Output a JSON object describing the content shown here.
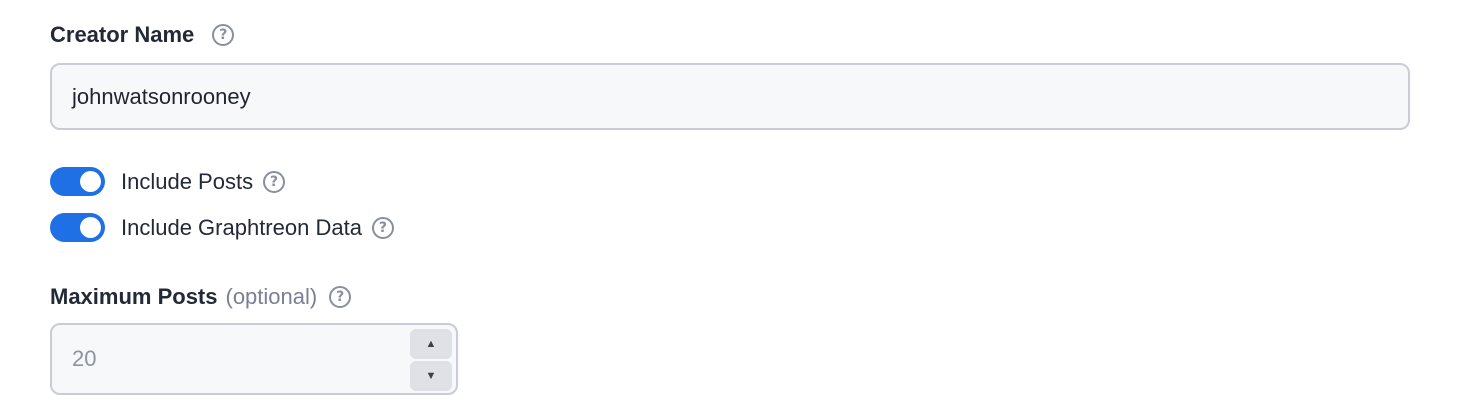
{
  "creator": {
    "label": "Creator Name",
    "help_icon": "question-circle-icon",
    "value": "johnwatsonrooney"
  },
  "toggles": [
    {
      "label": "Include Posts",
      "on": true,
      "help_icon": "question-circle-icon"
    },
    {
      "label": "Include Graphtreon Data",
      "on": true,
      "help_icon": "question-circle-icon"
    }
  ],
  "max_posts": {
    "label": "Maximum Posts",
    "optional": "(optional)",
    "help_icon": "question-circle-icon",
    "placeholder": "20",
    "increment_icon": "triangle-up-icon",
    "decrement_icon": "triangle-down-icon"
  },
  "colors": {
    "toggle_on": "#1f6fe5",
    "input_bg": "#f7f8fa",
    "input_border": "#c9ccd6",
    "help_icon": "#8a8f9f"
  }
}
